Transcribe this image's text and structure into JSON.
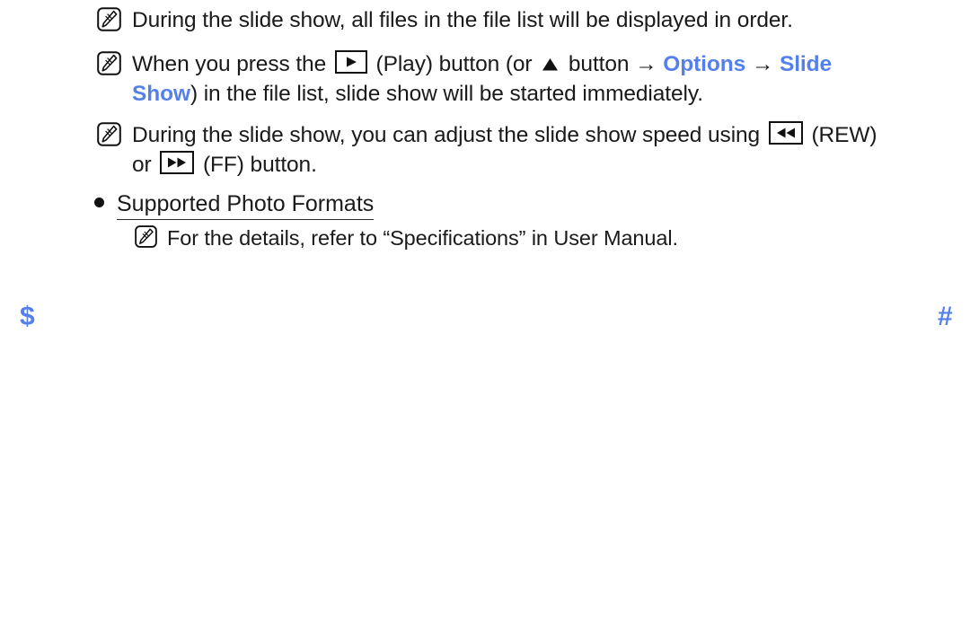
{
  "page": {
    "background_color": "#ffffff",
    "text_color": "#1a1a1a",
    "accent_color": "#5580ec"
  },
  "notes": [
    {
      "icon": "note-icon",
      "segments": [
        {
          "type": "text",
          "value": "During the slide show, all files in the file list will be displayed in order."
        }
      ],
      "plain": "During the slide show, all files in the file list will be displayed in order."
    },
    {
      "icon": "note-icon",
      "segments": [
        {
          "type": "text",
          "value": "When you press the "
        },
        {
          "type": "icon",
          "value": "play-button-icon"
        },
        {
          "type": "text",
          "value": " (Play) button (or "
        },
        {
          "type": "icon",
          "value": "triangle-up-icon"
        },
        {
          "type": "text",
          "value": " button "
        },
        {
          "type": "arrow",
          "value": "→"
        },
        {
          "type": "highlight",
          "value": "Options"
        },
        {
          "type": "arrow",
          "value": "→"
        },
        {
          "type": "highlight",
          "value": "Slide Show"
        },
        {
          "type": "text",
          "value": ") in the file list, slide show will be started immediately."
        }
      ],
      "plain": "When you press the (Play) button (or button → Options → Slide Show) in the file list, slide show will be started immediately."
    },
    {
      "icon": "note-icon",
      "segments": [
        {
          "type": "text",
          "value": "During the slide show, you can adjust the slide show speed using "
        },
        {
          "type": "icon",
          "value": "rewind-button-icon"
        },
        {
          "type": "text",
          "value": " (REW) or "
        },
        {
          "type": "icon",
          "value": "fast-forward-button-icon"
        },
        {
          "type": "text",
          "value": " (FF) button."
        }
      ],
      "plain": "During the slide show, you can adjust the slide show speed using (REW) or (FF) button."
    }
  ],
  "note_lines": {
    "line1": "During the slide show, all files in the file list will be displayed in order.",
    "line2_a": "When you press the ",
    "line2_b": " (Play) button (or ",
    "line2_c": " button ",
    "line2_arrow1": "→",
    "line2_options": "Options",
    "line2_arrow2": "→",
    "line2_slide": "Slide",
    "line2_show": "Show",
    "line2_tail": ") in the file list, slide show will be started immediately.",
    "line3_a": "During the slide show, you can adjust the slide show speed using ",
    "line3_b": " (REW)",
    "line3_c": "or ",
    "line3_d": " (FF) button.",
    "line4": "For the details, refer to “Specifications” in User Manual."
  },
  "section": {
    "heading": "Supported Photo Formats"
  },
  "navigation": {
    "prev_marker": "$",
    "next_marker": "#"
  }
}
